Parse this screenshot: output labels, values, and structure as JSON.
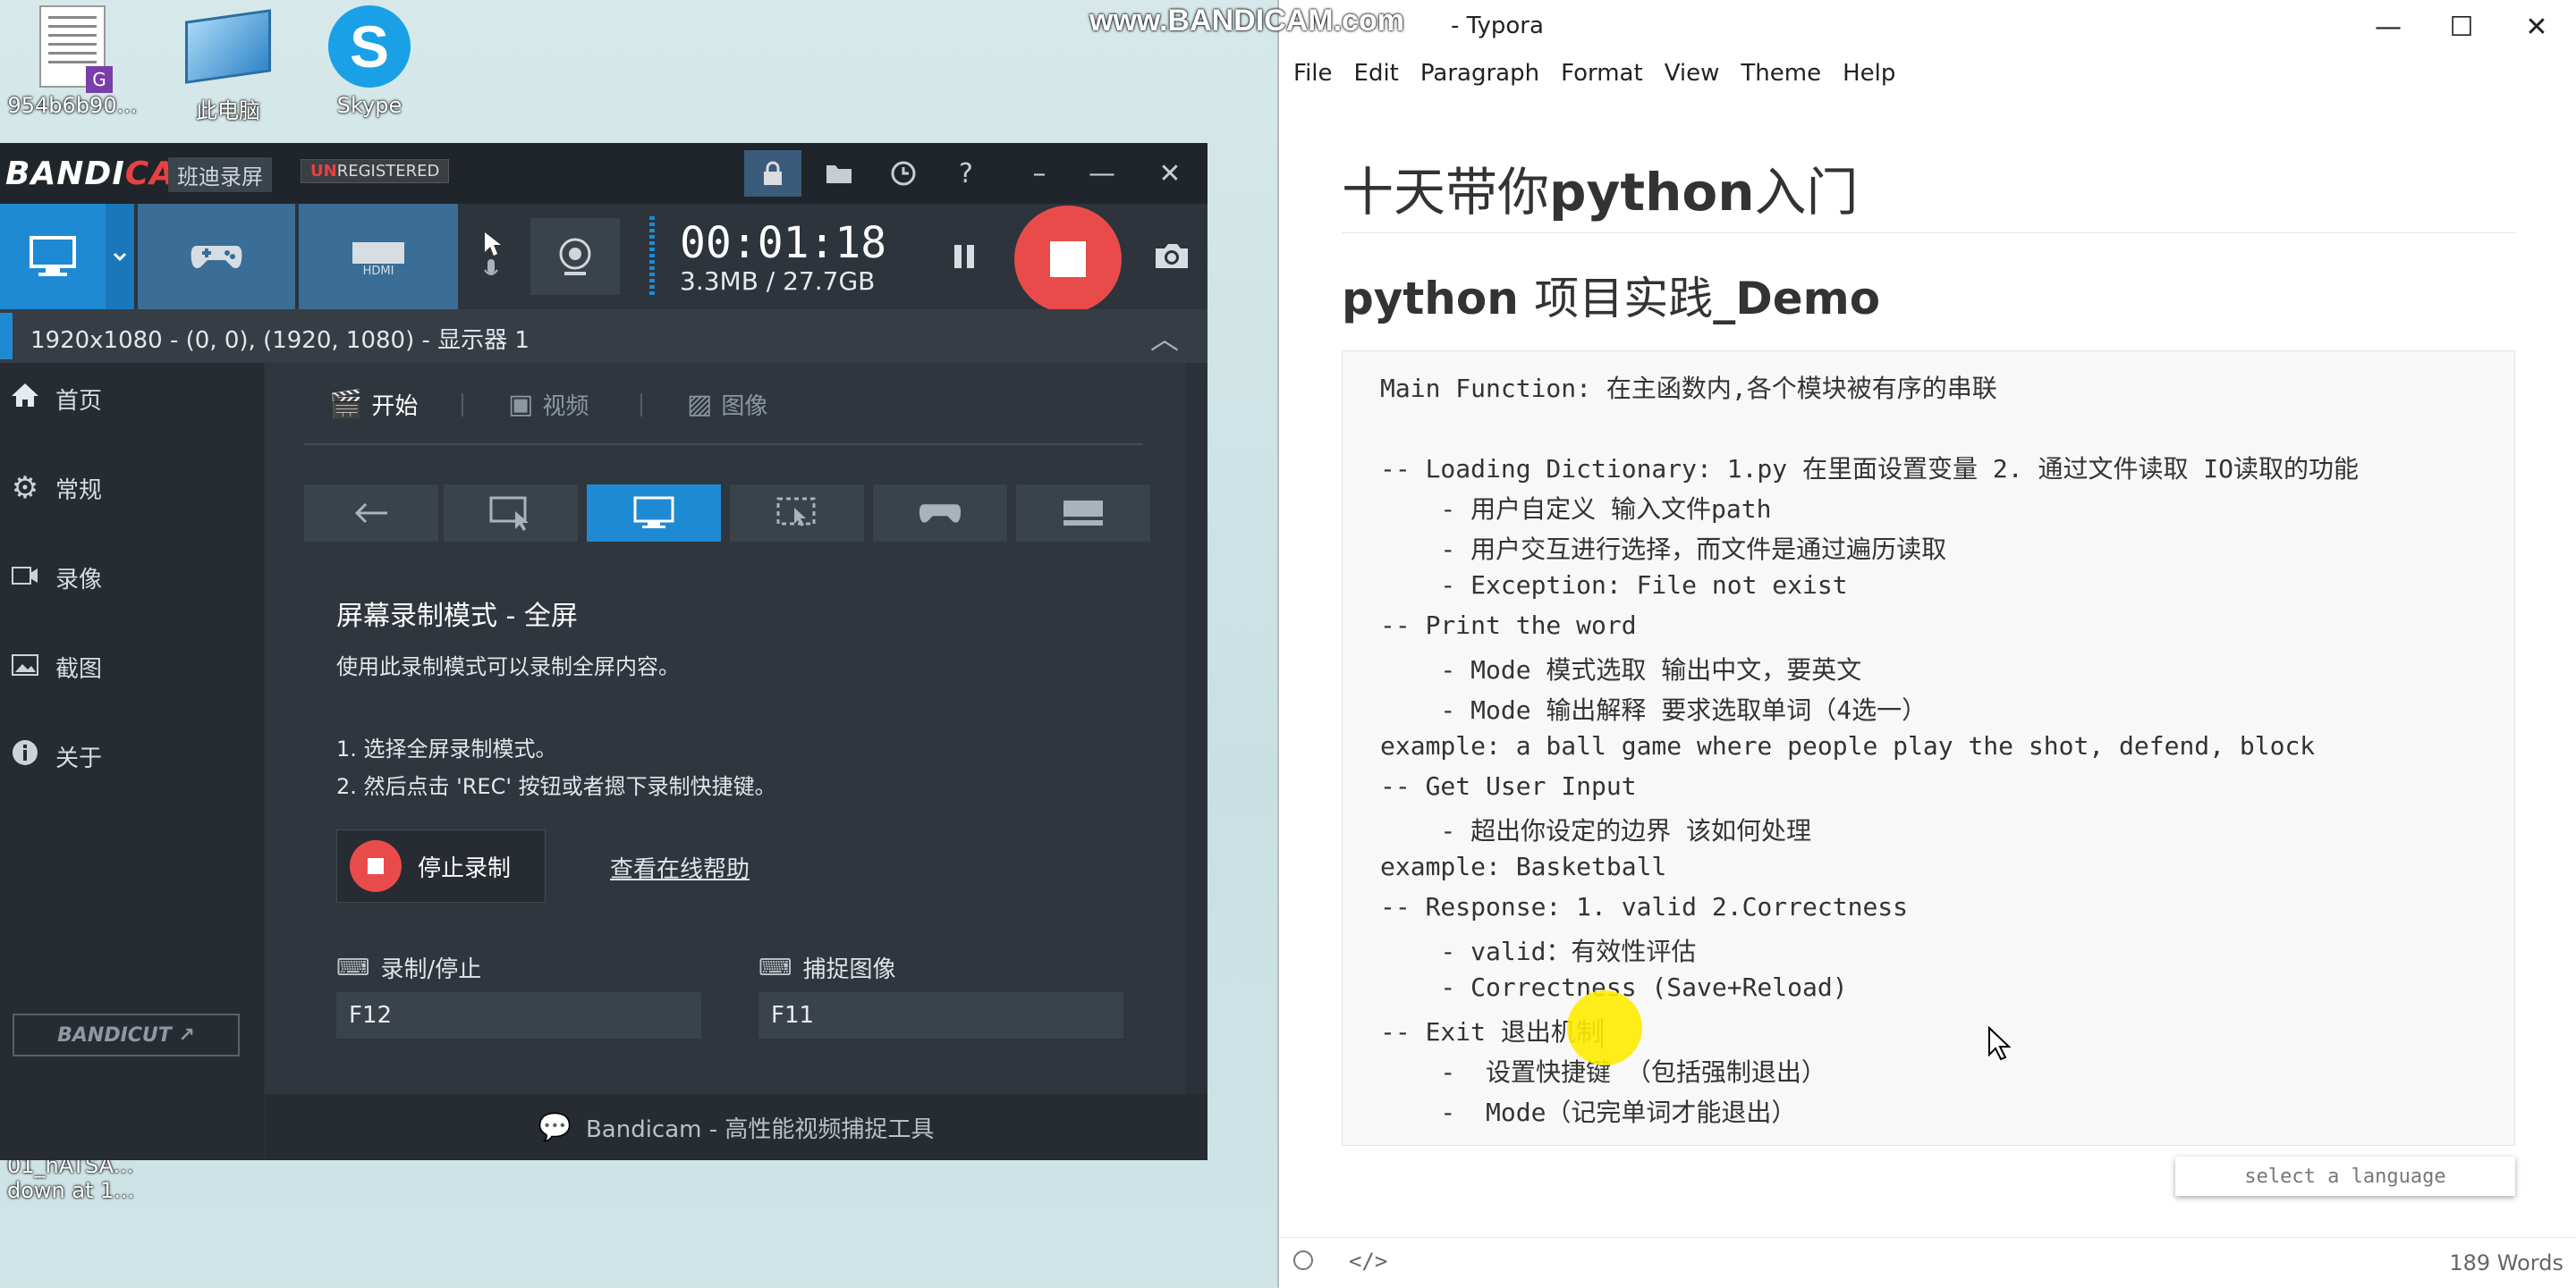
{
  "desktop": {
    "icons": [
      {
        "label": "954b6b90...",
        "icon": "document-icon"
      },
      {
        "label": "此电脑",
        "icon": "this-pc-icon"
      },
      {
        "label": "Skype",
        "icon": "skype-icon"
      }
    ],
    "bottom_texts": [
      "01_hATSA...",
      "down at 1..."
    ]
  },
  "watermark": "www.BANDICAM.com",
  "bandicam": {
    "logo": {
      "part1": "BANDI",
      "part2": "CAM"
    },
    "cn_name": "班迪录屏",
    "unregistered": {
      "prefix": "UN",
      "rest": "REGISTERED"
    },
    "title_buttons": [
      "lock-icon",
      "folder-icon",
      "clock-icon",
      "help-icon",
      "minimize-icon",
      "restore-icon",
      "close-icon"
    ],
    "modes": [
      "screen-mode-icon",
      "game-mode-icon",
      "hdmi-mode-icon"
    ],
    "timer": "00:01:18",
    "size": "3.3MB / 27.7GB",
    "resolution": "1920x1080 - (0, 0), (1920, 1080) - 显示器 1",
    "sidebar": [
      {
        "label": "首页",
        "icon": "home-icon"
      },
      {
        "label": "常规",
        "icon": "gear-icon"
      },
      {
        "label": "录像",
        "icon": "video-icon"
      },
      {
        "label": "截图",
        "icon": "image-icon"
      },
      {
        "label": "关于",
        "icon": "info-icon"
      }
    ],
    "bandicut": "BANDICUT ↗",
    "tabs": [
      {
        "label": "开始",
        "icon": "start-icon"
      },
      {
        "label": "视频",
        "icon": "video-icon"
      },
      {
        "label": "图像",
        "icon": "image-icon"
      }
    ],
    "mode_buttons": [
      "back-icon",
      "rectangle-mode-icon",
      "fullscreen-mode-icon",
      "around-mouse-icon",
      "game-mode-icon",
      "device-mode-icon"
    ],
    "heading": "屏幕录制模式 - 全屏",
    "description": "使用此录制模式可以录制全屏内容。",
    "steps": [
      "1. 选择全屏录制模式。",
      "2. 然后点击 'REC' 按钮或者摁下录制快捷键。"
    ],
    "stop_button": "停止录制",
    "help_link": "查看在线帮助",
    "hotkeys": [
      {
        "label": "录制/停止",
        "value": "F12"
      },
      {
        "label": "捕捉图像",
        "value": "F11"
      }
    ],
    "footer": "Bandicam - 高性能视频捕捉工具"
  },
  "typora": {
    "title": "- Typora",
    "menu": [
      "File",
      "Edit",
      "Paragraph",
      "Format",
      "View",
      "Theme",
      "Help"
    ],
    "h1": {
      "cn1": "十天带你",
      "en": "python",
      "cn2": "入门"
    },
    "h2": {
      "en1": "python ",
      "cn": "项目实践",
      "en2": "_Demo"
    },
    "code_lines": [
      "Main Function: 在主函数内,各个模块被有序的串联",
      "",
      "-- Loading Dictionary: 1.py 在里面设置变量 2. 通过文件读取 IO读取的功能",
      "    - 用户自定义 输入文件path",
      "    - 用户交互进行选择，而文件是通过遍历读取",
      "    - Exception: File not exist",
      "-- Print the word",
      "    - Mode 模式选取 输出中文，要英文",
      "    - Mode 输出解释 要求选取单词（4选一）",
      "example: a ball game where people play the shot, defend, block",
      "-- Get User Input",
      "    - 超出你设定的边界 该如何处理",
      "example: Basketball",
      "-- Response: 1. valid 2.Correctness",
      "    - valid：有效性评估",
      "    - Correctness (Save+Reload)",
      "-- Exit 退出机制",
      "    -  设置快捷键 （包括强制退出）",
      "    -  Mode（记完单词才能退出）"
    ],
    "language_select": "select a language",
    "status": {
      "word_count": "189 Words",
      "left_icons": [
        "circle-icon",
        "code-icon"
      ]
    }
  },
  "colors": {
    "bandicam_bg": "#2b3138",
    "accent_blue": "#1f8ad4",
    "rec_red": "#e94b4b",
    "cursor_highlight": "#ffeb00"
  }
}
